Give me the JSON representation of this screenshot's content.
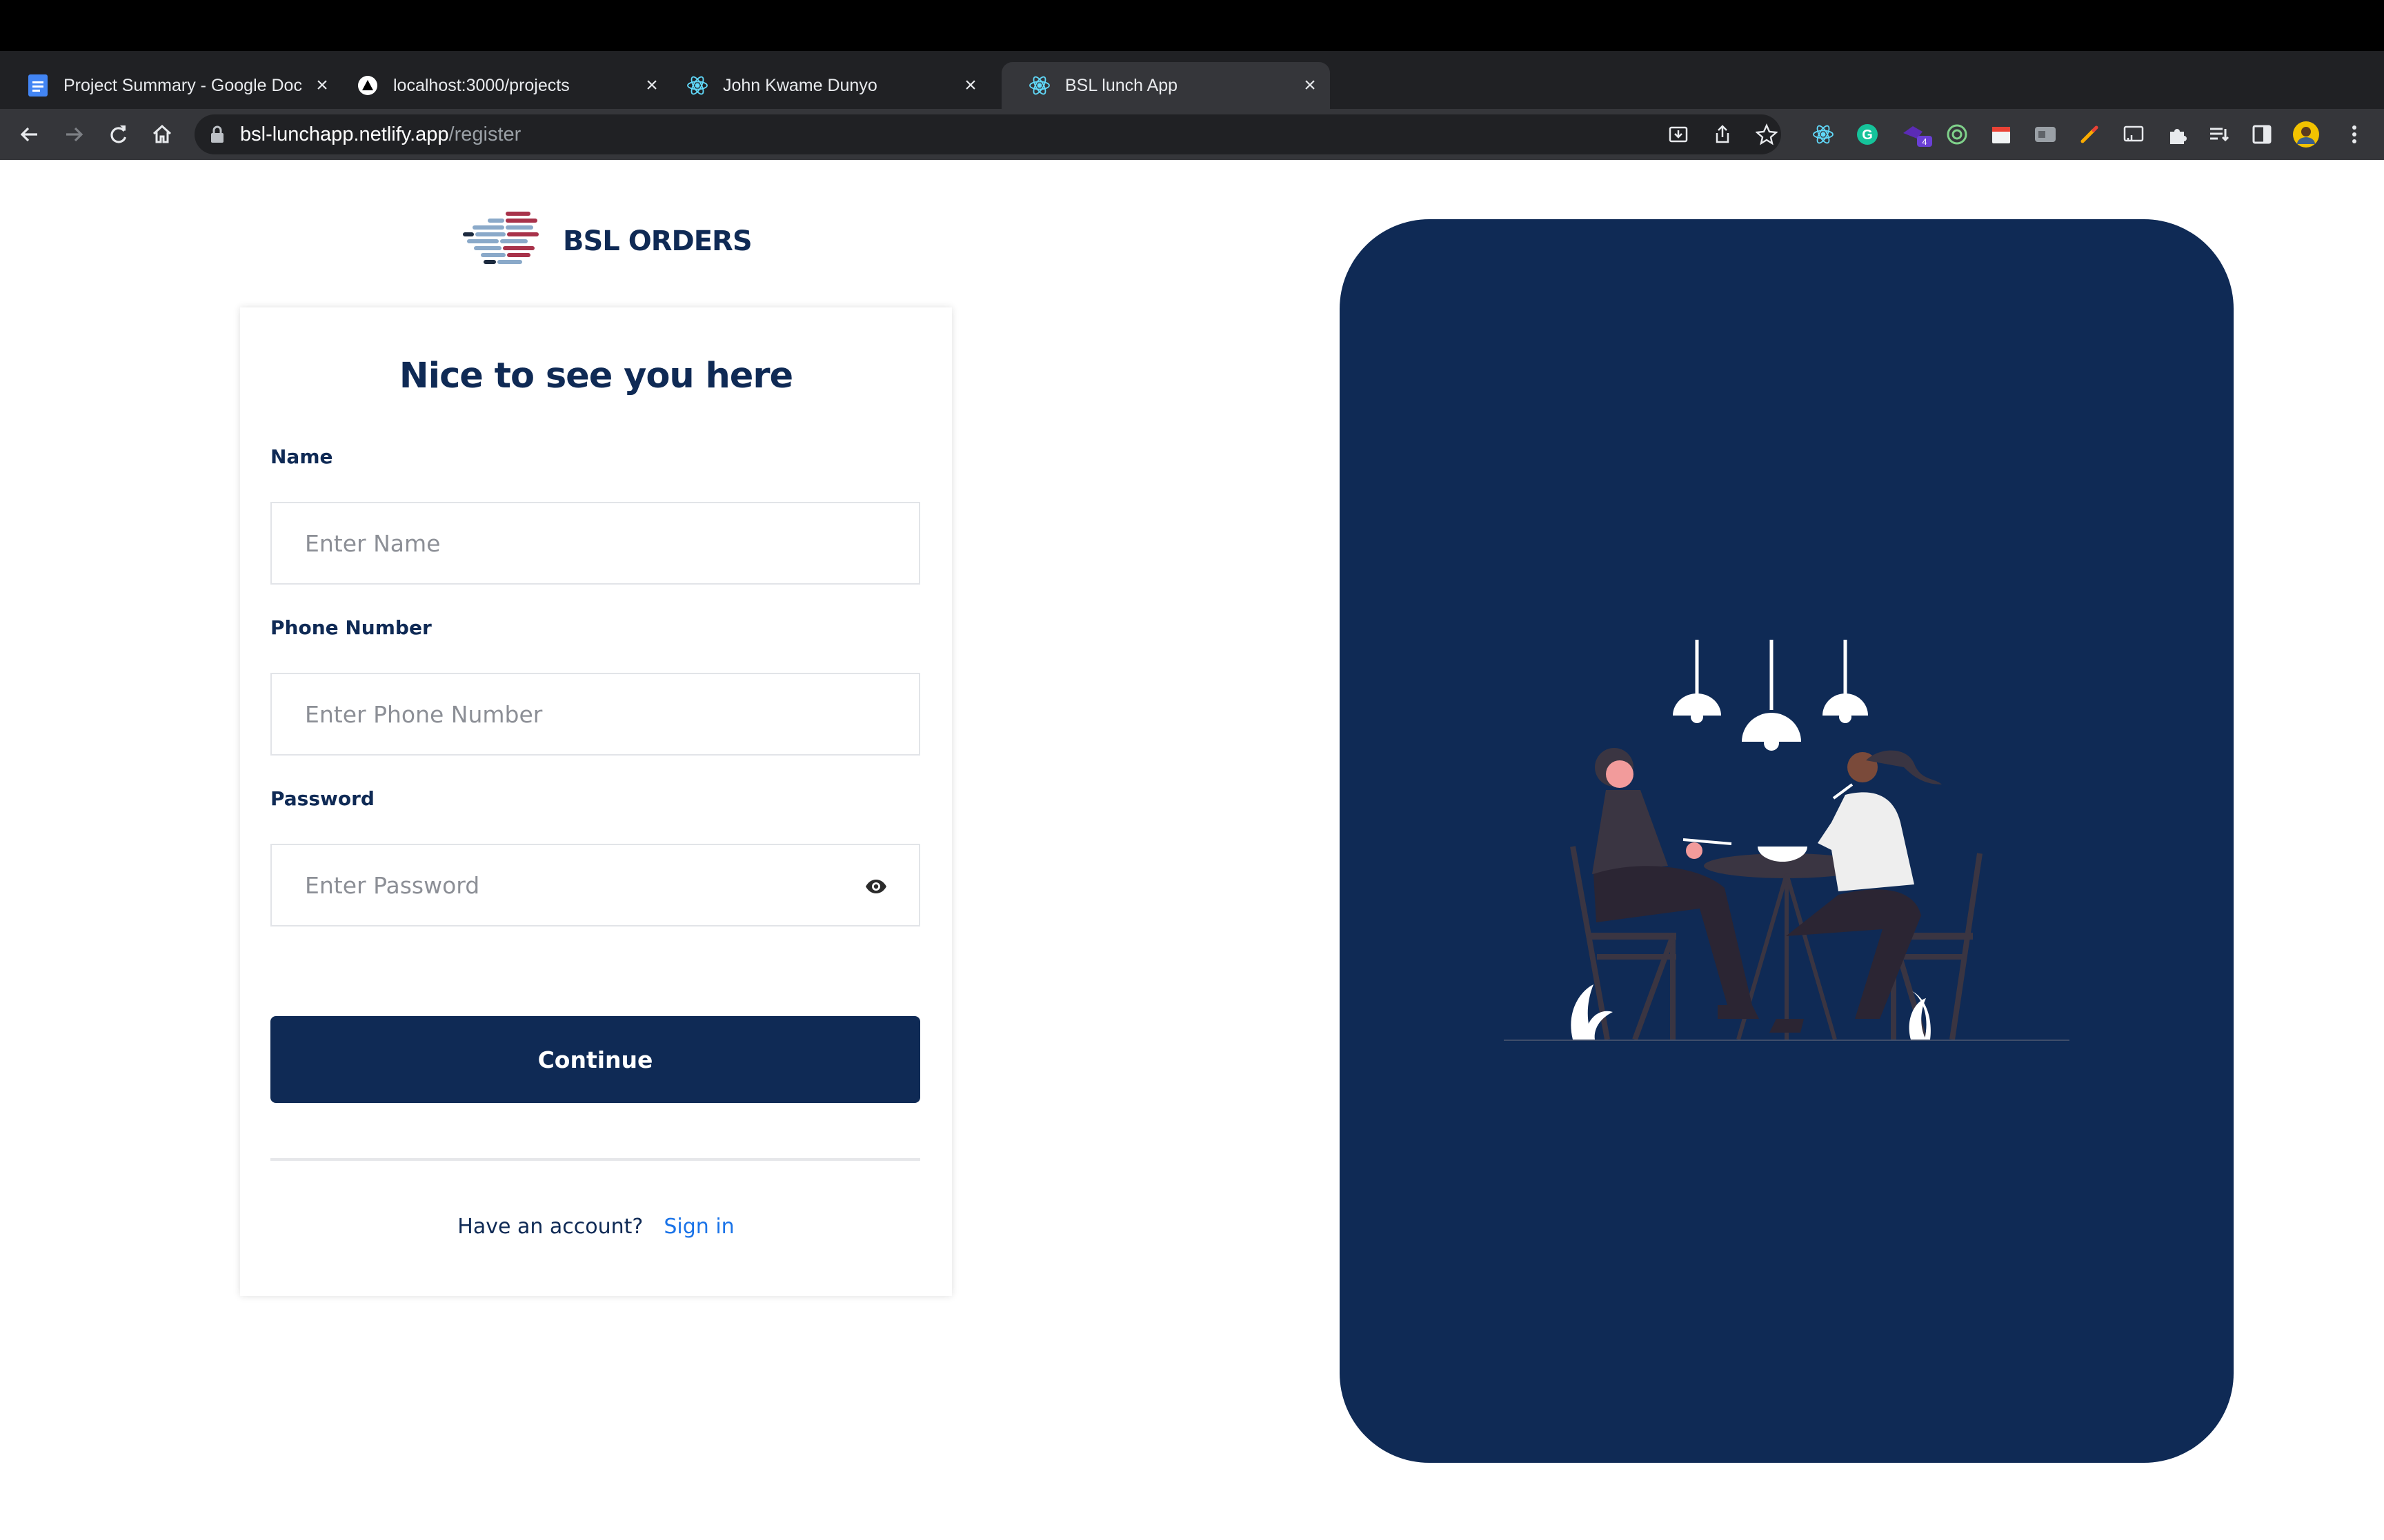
{
  "browser": {
    "tabs": [
      {
        "title": "Project Summary - Google Doc",
        "favicon": "google-docs-icon",
        "active": false
      },
      {
        "title": "localhost:3000/projects",
        "favicon": "triangle-icon",
        "active": false
      },
      {
        "title": "John Kwame Dunyo",
        "favicon": "react-icon",
        "active": false
      },
      {
        "title": "BSL lunch App",
        "favicon": "react-icon",
        "active": true
      }
    ],
    "url_host": "bsl-lunchapp.netlify.app",
    "url_path": "/register",
    "extension_badge": "4"
  },
  "page": {
    "logo_text": "BSL ORDERS",
    "heading": "Nice to see you here",
    "form": {
      "name_label": "Name",
      "name_placeholder": "Enter Name",
      "phone_label": "Phone Number",
      "phone_placeholder": "Enter Phone Number",
      "password_label": "Password",
      "password_placeholder": "Enter Password",
      "submit_label": "Continue"
    },
    "footer": {
      "prompt": "Have an account?",
      "link": "Sign in"
    }
  },
  "colors": {
    "brand_navy": "#0f2a55",
    "link_blue": "#1a73e8",
    "logo_red": "#a8324a",
    "logo_blue": "#8aa9c9"
  }
}
